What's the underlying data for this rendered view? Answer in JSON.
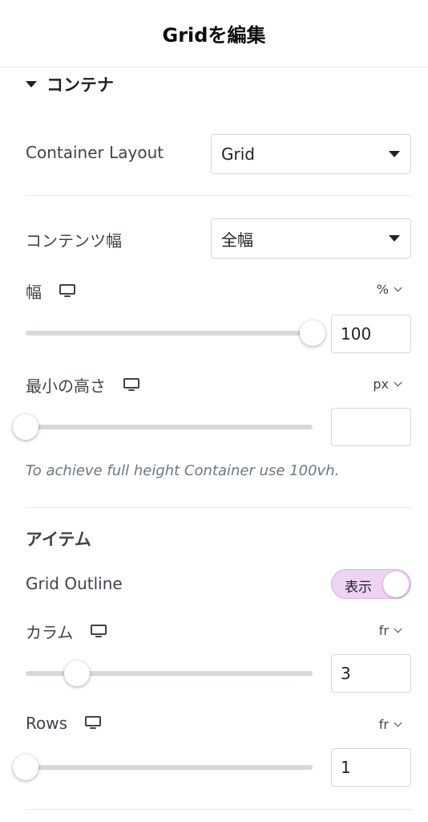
{
  "header": {
    "title": "Gridを編集"
  },
  "section": {
    "title": "コンテナ",
    "expanded_icon": "caret-down-icon"
  },
  "container_layout": {
    "label": "Container Layout",
    "value": "Grid"
  },
  "content_width": {
    "label": "コンテンツ幅",
    "value": "全幅"
  },
  "width": {
    "label": "幅",
    "device_icon": "desktop-icon",
    "unit": "%",
    "value": "100",
    "slider_fraction": 1.0
  },
  "min_height": {
    "label": "最小の高さ",
    "device_icon": "desktop-icon",
    "unit": "px",
    "value": "",
    "slider_fraction": 0.0,
    "note": "To achieve full height Container use 100vh."
  },
  "items": {
    "title": "アイテム"
  },
  "grid_outline": {
    "label": "Grid Outline",
    "toggle_label": "表示",
    "enabled": true
  },
  "columns": {
    "label": "カラム",
    "device_icon": "desktop-icon",
    "unit": "fr",
    "value": "3",
    "slider_fraction": 0.18
  },
  "rows": {
    "label": "Rows",
    "device_icon": "desktop-icon",
    "unit": "fr",
    "value": "1",
    "slider_fraction": 0.0
  },
  "colors": {
    "toggle_bg": "#ecd4f2",
    "track": "#d5d8dc",
    "border": "#d5d8dc"
  }
}
